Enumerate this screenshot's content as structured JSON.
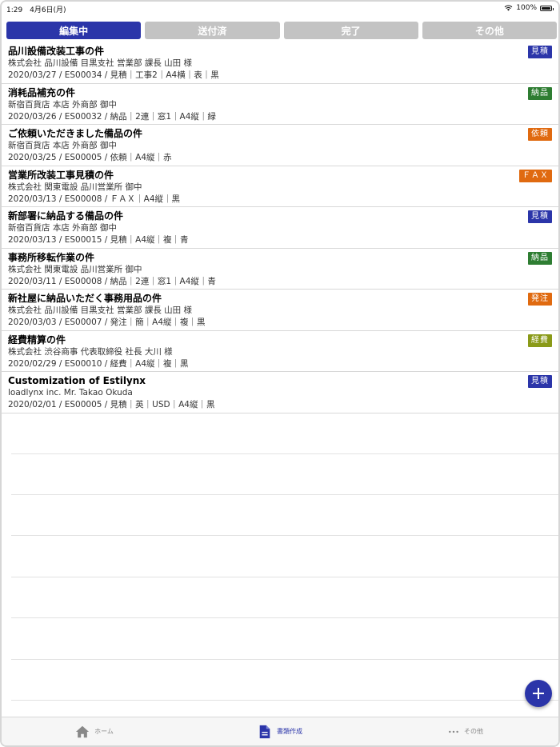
{
  "status": {
    "time": "1:29",
    "date": "4月6日(月)",
    "battery": "100%"
  },
  "tabs": [
    {
      "label": "編集中",
      "active": true
    },
    {
      "label": "送付済",
      "active": false
    },
    {
      "label": "完了",
      "active": false
    },
    {
      "label": "その他",
      "active": false
    }
  ],
  "documents": [
    {
      "title": "品川設備改装工事の件",
      "client": "株式会社 品川設備 目黒支社 営業部 課長 山田 様",
      "meta": "2020/03/27 / ES00034 / 見積｜工事2｜A4横｜表｜黒",
      "badge": "見積",
      "badge_color": "#2b35a9"
    },
    {
      "title": "消耗品補充の件",
      "client": "新宿百貨店 本店 外商部 御中",
      "meta": "2020/03/26 / ES00032 / 納品｜2連｜窓1｜A4縦｜緑",
      "badge": "納品",
      "badge_color": "#2e7d32"
    },
    {
      "title": "ご依頼いただきました備品の件",
      "client": "新宿百貨店 本店 外商部 御中",
      "meta": "2020/03/25 / ES00005 / 依頼｜A4縦｜赤",
      "badge": "依頼",
      "badge_color": "#e06a10"
    },
    {
      "title": "営業所改装工事見積の件",
      "client": "株式会社 関東電設 品川営業所 御中",
      "meta": "2020/03/13 / ES00008 / ＦＡＸ｜A4縦｜黒",
      "badge": "ＦＡＸ",
      "badge_color": "#e06a10"
    },
    {
      "title": "新部署に納品する備品の件",
      "client": "新宿百貨店 本店 外商部 御中",
      "meta": "2020/03/13 / ES00015 / 見積｜A4縦｜複｜青",
      "badge": "見積",
      "badge_color": "#2b35a9"
    },
    {
      "title": "事務所移転作業の件",
      "client": "株式会社 関東電設 品川営業所 御中",
      "meta": "2020/03/11 / ES00008 / 納品｜2連｜窓1｜A4縦｜青",
      "badge": "納品",
      "badge_color": "#2e7d32"
    },
    {
      "title": "新社屋に納品いただく事務用品の件",
      "client": "株式会社 品川設備 目黒支社 営業部 課長 山田 様",
      "meta": "2020/03/03 / ES00007 / 発注｜簡｜A4縦｜複｜黒",
      "badge": "発注",
      "badge_color": "#e06a10"
    },
    {
      "title": "経費精算の件",
      "client": "株式会社 渋谷商事 代表取締役 社長 大川 様",
      "meta": "2020/02/29 / ES00010 / 経費｜A4縦｜複｜黒",
      "badge": "経費",
      "badge_color": "#8a9a18"
    },
    {
      "title": "Customization of Estilynx",
      "client": "loadlynx inc. Mr. Takao Okuda",
      "meta": "2020/02/01 / ES00005 / 見積｜英｜USD｜A4縦｜黒",
      "badge": "見積",
      "badge_color": "#2b35a9"
    }
  ],
  "icons": {
    "fab": "plus-icon",
    "home": "home-icon",
    "docs": "document-icon",
    "more": "more-icon"
  },
  "bottom_nav": [
    {
      "label": "ホーム",
      "icon": "home-icon",
      "active": false
    },
    {
      "label": "書類作成",
      "icon": "document-icon",
      "active": true
    },
    {
      "label": "その他",
      "icon": "more-icon",
      "active": false
    }
  ],
  "colors": {
    "accent": "#2b35a9",
    "tab_inactive": "#c3c3c3"
  }
}
